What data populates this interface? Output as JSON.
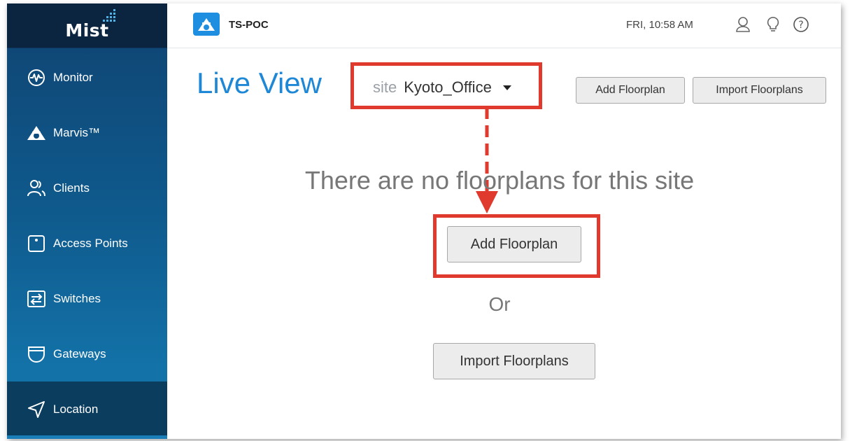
{
  "sidebar": {
    "logo": "Mist",
    "items": [
      {
        "label": "Monitor",
        "icon": "monitor-wave-icon"
      },
      {
        "label": "Marvis™",
        "icon": "marvis-icon"
      },
      {
        "label": "Clients",
        "icon": "clients-icon"
      },
      {
        "label": "Access Points",
        "icon": "access-point-icon"
      },
      {
        "label": "Switches",
        "icon": "switch-icon"
      },
      {
        "label": "Gateways",
        "icon": "gateway-icon"
      },
      {
        "label": "Location",
        "icon": "location-icon"
      }
    ],
    "active_item": "Location"
  },
  "header": {
    "org_name": "TS-POC",
    "time": "FRI, 10:58 AM",
    "icons": [
      "user-icon",
      "lightbulb-icon",
      "help-icon"
    ]
  },
  "main": {
    "title": "Live View",
    "site_selector": {
      "label": "site",
      "value": "Kyoto_Office"
    },
    "add_floorplan_small": "Add Floorplan",
    "import_floorplans_small": "Import Floorplans",
    "empty_message": "There are no floorplans for this site",
    "add_floorplan_big": "Add Floorplan",
    "or_text": "Or",
    "import_floorplans_big": "Import Floorplans"
  },
  "colors": {
    "accent": "#1e88d6",
    "highlight": "#e03a2e",
    "sidebar_top": "#0b2541",
    "sidebar_active": "#0b3d5f"
  }
}
